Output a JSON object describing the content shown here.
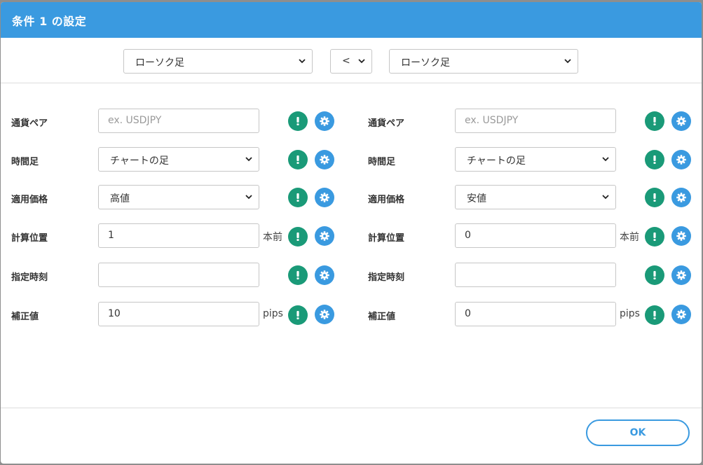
{
  "dialog": {
    "title": "条件 1 の設定",
    "ok_label": "OK"
  },
  "top_bar": {
    "left_source": "ローソク足",
    "operator": "<",
    "right_source": "ローソク足"
  },
  "left": {
    "pair_label": "通貨ペア",
    "pair_placeholder": "ex. USDJPY",
    "pair_value": "",
    "timeframe_label": "時間足",
    "timeframe_value": "チャートの足",
    "price_label": "適用価格",
    "price_value": "高値",
    "position_label": "計算位置",
    "position_value": "1",
    "position_unit": "本前",
    "time_label": "指定時刻",
    "time_value": "",
    "offset_label": "補正値",
    "offset_value": "10",
    "offset_unit": "pips"
  },
  "right": {
    "pair_label": "通貨ペア",
    "pair_placeholder": "ex. USDJPY",
    "pair_value": "",
    "timeframe_label": "時間足",
    "timeframe_value": "チャートの足",
    "price_label": "適用価格",
    "price_value": "安値",
    "position_label": "計算位置",
    "position_value": "0",
    "position_unit": "本前",
    "time_label": "指定時刻",
    "time_value": "",
    "offset_label": "補正値",
    "offset_value": "0",
    "offset_unit": "pips"
  },
  "icons": {
    "alert": "exclamation-icon",
    "settings": "gear-icon"
  },
  "colors": {
    "accent": "#3a9ae0",
    "alert_green": "#1a9a78"
  }
}
